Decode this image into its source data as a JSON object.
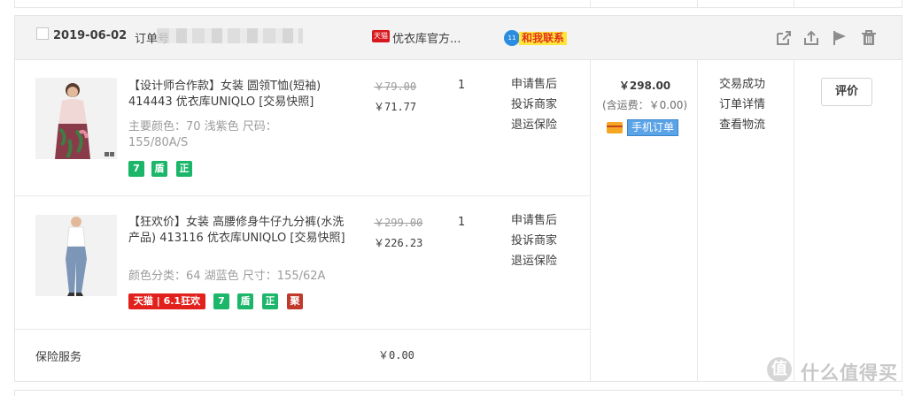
{
  "order": {
    "date": "2019-06-02",
    "order_no_label": "订单号",
    "shop": {
      "badge": "天猫",
      "name": "优衣库官方..."
    },
    "contact": {
      "badge": "11",
      "label": "和我联系"
    },
    "items": [
      {
        "title": "【设计师合作款】女装 圆领T恤(短袖) 414443 优衣库UNIQLO [交易快照]",
        "attrs": "主要颜色：70 浅紫色  尺码：155/80A/S",
        "original_price": "￥79.00",
        "price": "￥71.77",
        "qty": "1",
        "actions": [
          "申请售后",
          "投诉商家",
          "退运保险"
        ],
        "badges": [
          "7",
          "盾",
          "正"
        ]
      },
      {
        "title": "【狂欢价】女装 高腰修身牛仔九分裤(水洗产品) 413116 优衣库UNIQLO [交易快照]",
        "attrs": "颜色分类：64 湖蓝色  尺寸：155/62A",
        "original_price": "￥299.00",
        "price": "￥226.23",
        "qty": "1",
        "actions": [
          "申请售后",
          "投诉商家",
          "退运保险"
        ],
        "promo": "天猫 | 6.1狂欢",
        "badges": [
          "7",
          "盾",
          "正",
          "聚"
        ]
      }
    ],
    "insurance": {
      "label": "保险服务",
      "price": "￥0.00"
    },
    "total": "￥298.00",
    "shipping": "(含运费：￥0.00)",
    "mobile_label": "手机订单",
    "status_links": [
      "交易成功",
      "订单详情",
      "查看物流"
    ],
    "review_button": "评价"
  },
  "watermark": {
    "badge": "值",
    "text": "什么值得买"
  },
  "colors": {
    "header_bg": "#f3f3f3",
    "tmall_red": "#d8171f",
    "badge_green": "#1bb66a",
    "link_blue": "#2b8de0"
  },
  "icons": [
    "share-icon",
    "upload-icon",
    "flag-icon",
    "trash-icon"
  ]
}
